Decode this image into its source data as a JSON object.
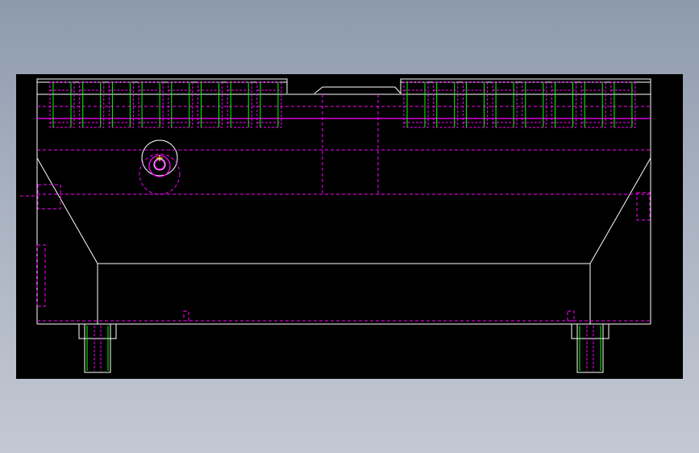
{
  "viewer": {
    "background_color": "#000000",
    "page_gradient_top": "#8d9aae",
    "page_gradient_bottom": "#c3c8d2"
  },
  "drawing": {
    "kind": "mechanical-cad-section-view",
    "layers": {
      "outline": "#ffffff",
      "hidden_lines": "#ff00ff",
      "fastener_threads": "#00ff00",
      "center_marks": "#ffff00"
    },
    "rollers_left_count": 8,
    "rollers_right_count": 8,
    "bottom_bolts_count": 2,
    "side_screws_count": 2
  }
}
